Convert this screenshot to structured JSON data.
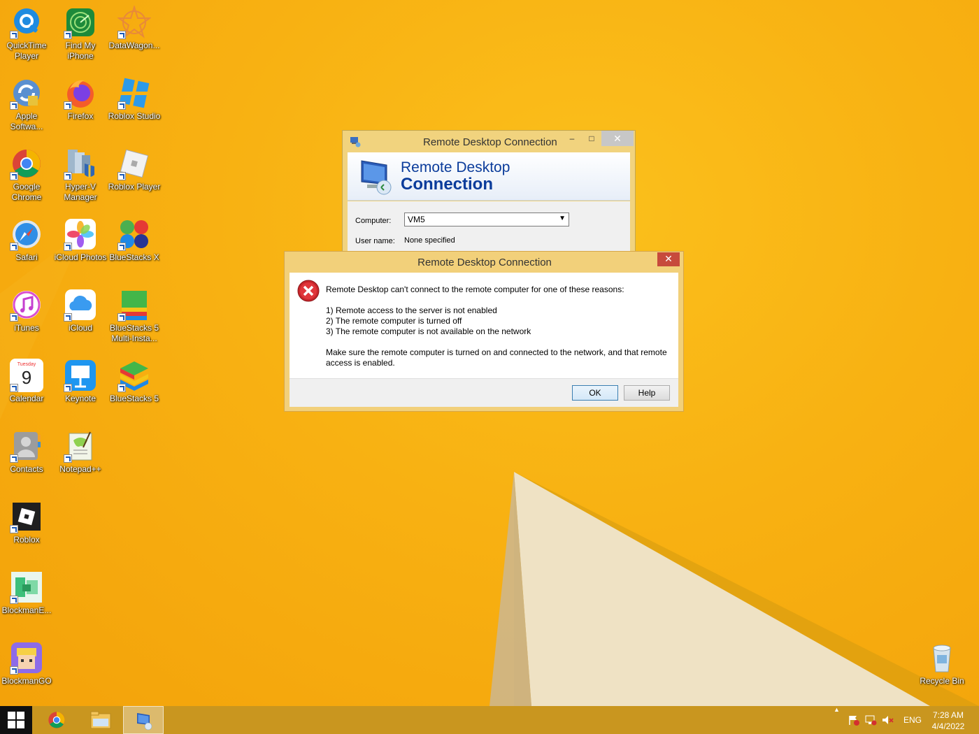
{
  "desktop": {
    "icons": [
      {
        "label": "QuickTime Player",
        "icon": "quicktime-icon"
      },
      {
        "label": "Find My iPhone",
        "icon": "find-my-iphone-icon"
      },
      {
        "label": "DataWagon...",
        "icon": "datawagon-icon"
      },
      {
        "label": "Apple Softwa...",
        "icon": "apple-software-update-icon"
      },
      {
        "label": "Firefox",
        "icon": "firefox-icon"
      },
      {
        "label": "Roblox Studio",
        "icon": "roblox-studio-icon"
      },
      {
        "label": "Google Chrome",
        "icon": "chrome-icon"
      },
      {
        "label": "Hyper-V Manager",
        "icon": "hyper-v-icon"
      },
      {
        "label": "Roblox Player",
        "icon": "roblox-player-icon"
      },
      {
        "label": "Safari",
        "icon": "safari-icon"
      },
      {
        "label": "iCloud Photos",
        "icon": "icloud-photos-icon"
      },
      {
        "label": "BlueStacks X",
        "icon": "bluestacks-x-icon"
      },
      {
        "label": "iTunes",
        "icon": "itunes-icon"
      },
      {
        "label": "iCloud",
        "icon": "icloud-icon"
      },
      {
        "label": "BlueStacks 5 Multi-Insta...",
        "icon": "bluestacks-multi-icon"
      },
      {
        "label": "Calendar",
        "icon": "calendar-icon",
        "day": "Tuesday",
        "date": "9"
      },
      {
        "label": "Keynote",
        "icon": "keynote-icon"
      },
      {
        "label": "BlueStacks 5",
        "icon": "bluestacks-5-icon"
      },
      {
        "label": "Contacts",
        "icon": "contacts-icon"
      },
      {
        "label": "Notepad++",
        "icon": "notepadpp-icon"
      },
      {
        "label": "Roblox",
        "icon": "roblox-icon"
      },
      {
        "label": "BlockmanE...",
        "icon": "blockman-editor-icon"
      },
      {
        "label": "BlockmanGO",
        "icon": "blockmango-icon"
      },
      {
        "label": "Recycle Bin",
        "icon": "recycle-bin-icon"
      }
    ]
  },
  "rdc_window": {
    "title": "Remote Desktop Connection",
    "banner_line1": "Remote Desktop",
    "banner_line2": "Connection",
    "computer_label": "Computer:",
    "computer_value": "VM5",
    "username_label": "User name:",
    "username_value": "None specified",
    "minimize": "–",
    "maximize": "□",
    "close": "✕"
  },
  "error_dialog": {
    "title": "Remote Desktop Connection",
    "close": "✕",
    "message_intro": "Remote Desktop can't connect to the remote computer for one of these reasons:",
    "reasons": [
      "1) Remote access to the server is not enabled",
      "2) The remote computer is turned off",
      "3) The remote computer is not available on the network"
    ],
    "advice_line1": "Make sure the remote computer is turned on and connected to the network, and that remote",
    "advice_line2": "access is enabled.",
    "ok_label": "OK",
    "help_label": "Help"
  },
  "taskbar": {
    "language": "ENG",
    "time": "7:28 AM",
    "date": "4/4/2022",
    "tray_expand": "▲"
  }
}
